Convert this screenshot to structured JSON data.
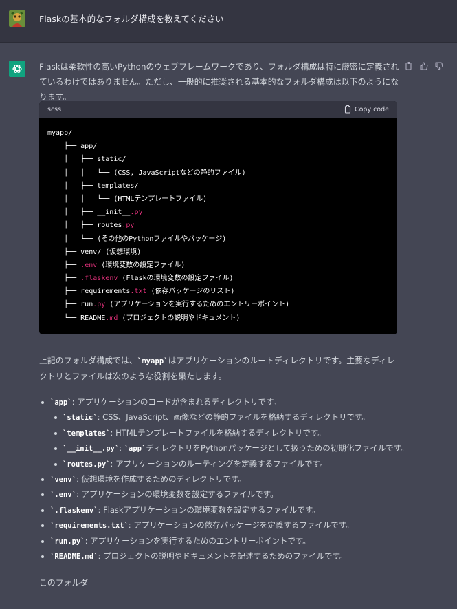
{
  "user_message": "Flaskの基本的なフォルダ構成を教えてください",
  "intro": "Flaskは柔軟性の高いPythonのウェブフレームワークであり、フォルダ構成は特に厳密に定義されているわけではありません。ただし、一般的に推奨される基本的なフォルダ構成は以下のようになります。",
  "code_block": {
    "language": "scss",
    "copy_label": "Copy code",
    "lines": [
      "myapp/",
      "    ├── app/",
      "    │   ├── static/",
      "    │   │   └── (CSS, JavaScriptなどの静的ファイル)",
      "    │   ├── templates/",
      "    │   │   └── (HTMLテンプレートファイル)",
      "    │   ├── __init__",
      "    │   ├── routes",
      "    │   └── (その他のPythonファイルやパッケージ)",
      "    ├── venv/ (仮想環境)",
      "    ├── ",
      "    ├── ",
      "    ├── requirements",
      "    ├── run",
      "    └── README"
    ],
    "ext_py": ".py",
    "ext_env": ".env",
    "ext_flaskenv": ".flaskenv",
    "ext_txt": ".txt",
    "ext_md": ".md",
    "suffix_env": " (環境変数の設定ファイル)",
    "suffix_flaskenv": " (Flaskの環境変数の設定ファイル)",
    "suffix_req": " (依存パッケージのリスト)",
    "suffix_run": " (アプリケーションを実行するためのエントリーポイント)",
    "suffix_readme": " (プロジェクトの説明やドキュメント)"
  },
  "summary": {
    "before": "上記のフォルダ構成では、",
    "code": "`myapp`",
    "after": "はアプリケーションのルートディレクトリです。主要なディレクトリとファイルは次のような役割を果たします。"
  },
  "bullets": [
    {
      "level": 1,
      "code": "`app`",
      "text": ": アプリケーションのコードが含まれるディレクトリです。"
    },
    {
      "level": 2,
      "code": "`static`",
      "text": ": CSS、JavaScript、画像などの静的ファイルを格納するディレクトリです。"
    },
    {
      "level": 2,
      "code": "`templates`",
      "text": ": HTMLテンプレートファイルを格納するディレクトリです。"
    },
    {
      "level": 2,
      "code": "`__init__.py`",
      "text": ": ",
      "code2": "`app`",
      "text2": "ディレクトリをPythonパッケージとして扱うための初期化ファイルです。"
    },
    {
      "level": 2,
      "code": "`routes.py`",
      "text": ": アプリケーションのルーティングを定義するファイルです。"
    },
    {
      "level": 1,
      "code": "`venv`",
      "text": ": 仮想環境を作成するためのディレクトリです。"
    },
    {
      "level": 1,
      "code": "`.env`",
      "text": ": アプリケーションの環境変数を設定するファイルです。"
    },
    {
      "level": 1,
      "code": "`.flaskenv`",
      "text": ": Flaskアプリケーションの環境変数を設定するファイルです。"
    },
    {
      "level": 1,
      "code": "`requirements.txt`",
      "text": ": アプリケーションの依存パッケージを定義するファイルです。"
    },
    {
      "level": 1,
      "code": "`run.py`",
      "text": ": アプリケーションを実行するためのエントリーポイントです。"
    },
    {
      "level": 1,
      "code": "`README.md`",
      "text": ": プロジェクトの説明やドキュメントを記述するためのファイルです。"
    }
  ],
  "trailing": "このフォルダ",
  "colors": {
    "user_bg": "#343541",
    "bot_bg": "#444654",
    "accent": "#10a37f",
    "code_ext": "#df3079"
  }
}
